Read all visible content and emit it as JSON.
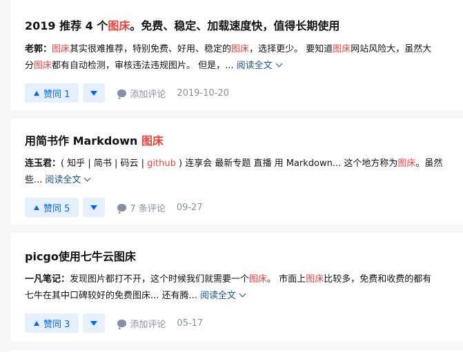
{
  "colors": {
    "highlight": "#f1403c",
    "link": "#175199",
    "vote_bg": "#e5effe",
    "vote_fg": "#0066ff",
    "meta": "#8590a6"
  },
  "icons": {
    "vote_up": "triangle-up-icon",
    "vote_down": "triangle-down-icon",
    "comment": "comment-bubble-icon",
    "expand": "chevron-down-icon"
  },
  "cards": [
    {
      "title": {
        "pre": "2019 推荐 4 个",
        "hl": "图床",
        "post": "。免费、稳定、加载速度快，值得长期使用"
      },
      "excerpt": {
        "line1": {
          "author": "老郭：",
          "seg1": "",
          "hl1": "图床",
          "seg2": "其实很难推荐，特别免费、好用、稳定的",
          "hl2": "图床",
          "seg3": "，选择更少。 要知道",
          "hl3": "图床",
          "seg4": "网站风险大，虽然大"
        },
        "line2": {
          "seg1": "分",
          "hl1": "图床",
          "seg2": "都有自动检测，审核违法违规图片。 但是，..."
        }
      },
      "read_more": "阅读全文",
      "vote_label": "赞同 1",
      "comment_label": "添加评论",
      "date": "2019-10-20"
    },
    {
      "title": {
        "pre": "用简书作 Markdown ",
        "hl": "图床",
        "post": ""
      },
      "excerpt": {
        "line1": {
          "author": "连玉君：",
          "seg1": "( 知乎 | 简书 | 码云 | ",
          "hl1": "github",
          "seg2": " ) 连享会 最新专题 直播 用 Markdown... 这个地方称为",
          "hl2": "图床",
          "seg3": "。虽然"
        },
        "line2": {
          "seg1": "些..."
        }
      },
      "read_more": "阅读全文",
      "vote_label": "赞同 5",
      "comment_label": "7 条评论",
      "date": "09-27"
    },
    {
      "title": {
        "pre": "picgo使用七牛云图床",
        "hl": "",
        "post": ""
      },
      "excerpt": {
        "line1": {
          "author": "一凡笔记：",
          "seg1": "发现图片都打不开，这个时候我们就需要一个",
          "hl1": "图床",
          "seg2": "。 市面上",
          "hl2": "图床",
          "seg3": "比较多，免费和收费的都有"
        },
        "line2": {
          "seg1": "七牛在其中口碑较好的免费图床... 还有腾..."
        }
      },
      "read_more": "阅读全文",
      "vote_label": "赞同 3",
      "comment_label": "添加评论",
      "date": "05-17"
    }
  ]
}
